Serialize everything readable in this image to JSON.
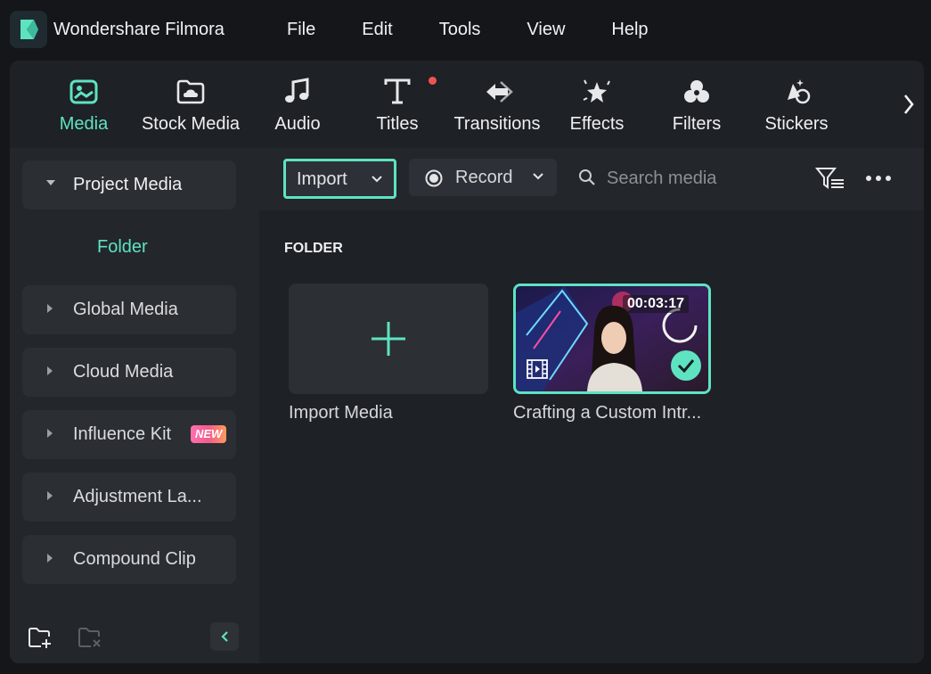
{
  "app": {
    "title": "Wondershare Filmora",
    "logo_icon": "filmora-logo-icon"
  },
  "menu": [
    "File",
    "Edit",
    "Tools",
    "View",
    "Help"
  ],
  "toolbar": {
    "items": [
      {
        "label": "Media",
        "icon": "media-icon",
        "active": true
      },
      {
        "label": "Stock Media",
        "icon": "cloud-folder-icon",
        "active": false
      },
      {
        "label": "Audio",
        "icon": "music-note-icon",
        "active": false
      },
      {
        "label": "Titles",
        "icon": "text-t-icon",
        "active": false,
        "notification": true
      },
      {
        "label": "Transitions",
        "icon": "transitions-icon",
        "active": false
      },
      {
        "label": "Effects",
        "icon": "magic-wand-icon",
        "active": false
      },
      {
        "label": "Filters",
        "icon": "filters-icon",
        "active": false
      },
      {
        "label": "Stickers",
        "icon": "stickers-icon",
        "active": false
      }
    ],
    "next_icon": "chevron-right-icon"
  },
  "sidebar": {
    "items": [
      {
        "label": "Project Media",
        "expanded": true
      },
      {
        "label": "Global Media",
        "expanded": false
      },
      {
        "label": "Cloud Media",
        "expanded": false
      },
      {
        "label": "Influence Kit",
        "expanded": false,
        "badge": "NEW"
      },
      {
        "label": "Adjustment La...",
        "expanded": false
      },
      {
        "label": "Compound Clip",
        "expanded": false
      }
    ],
    "folder_link": "Folder",
    "footer": {
      "new_folder_icon": "new-folder-icon",
      "delete_folder_icon": "delete-folder-icon",
      "collapse_icon": "chevron-left-icon"
    }
  },
  "content": {
    "import_button": "Import",
    "record_button": "Record",
    "search_placeholder": "Search media",
    "section_heading": "FOLDER",
    "import_tile_caption": "Import Media",
    "clip": {
      "caption": "Crafting a Custom Intr...",
      "duration": "00:03:17",
      "selected": true
    }
  },
  "colors": {
    "accent": "#5ee3c1",
    "notification": "#f0544f",
    "background": "#141619",
    "panel": "#1e2126"
  }
}
